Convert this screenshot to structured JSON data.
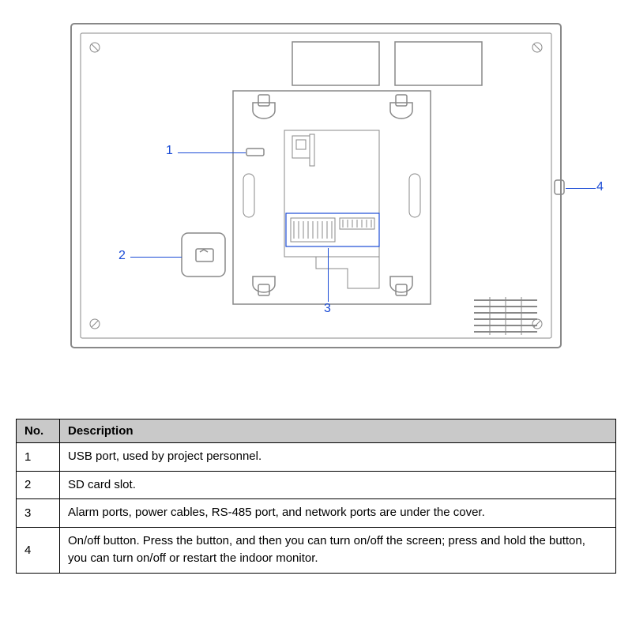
{
  "callouts": {
    "c1": "1",
    "c2": "2",
    "c3": "3",
    "c4": "4"
  },
  "table": {
    "header_no": "No.",
    "header_desc": "Description",
    "rows": [
      {
        "no": "1",
        "desc": "USB port, used by project personnel."
      },
      {
        "no": "2",
        "desc": "SD card slot."
      },
      {
        "no": "3",
        "desc": "Alarm ports, power cables, RS-485 port, and network ports are under the cover."
      },
      {
        "no": "4",
        "desc": "On/off button. Press the button, and then you can turn on/off the screen; press and hold the button, you can turn on/off or restart the indoor monitor."
      }
    ]
  }
}
